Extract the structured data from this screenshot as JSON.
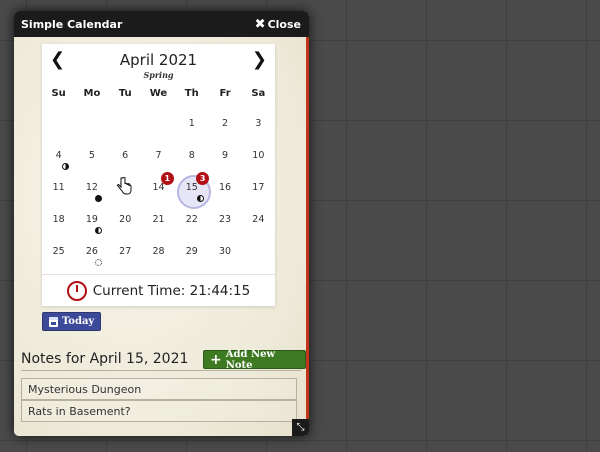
{
  "window": {
    "title": "Simple Calendar",
    "close_label": "Close"
  },
  "calendar": {
    "month_year": "April 2021",
    "season": "Spring",
    "weekdays": [
      "Su",
      "Mo",
      "Tu",
      "We",
      "Th",
      "Fr",
      "Sa"
    ],
    "days": [
      {
        "n": ""
      },
      {
        "n": ""
      },
      {
        "n": ""
      },
      {
        "n": ""
      },
      {
        "n": "1"
      },
      {
        "n": "2"
      },
      {
        "n": "3"
      },
      {
        "n": "4",
        "moon": "half-right"
      },
      {
        "n": "5"
      },
      {
        "n": "6"
      },
      {
        "n": "7"
      },
      {
        "n": "8"
      },
      {
        "n": "9"
      },
      {
        "n": "10"
      },
      {
        "n": "11"
      },
      {
        "n": "12",
        "moon": "new"
      },
      {
        "n": "13"
      },
      {
        "n": "14",
        "badge": "1"
      },
      {
        "n": "15",
        "badge": "3",
        "moon": "half-left",
        "selected": true
      },
      {
        "n": "16"
      },
      {
        "n": "17"
      },
      {
        "n": "18"
      },
      {
        "n": "19",
        "moon": "half-left"
      },
      {
        "n": "20"
      },
      {
        "n": "21"
      },
      {
        "n": "22"
      },
      {
        "n": "23"
      },
      {
        "n": "24"
      },
      {
        "n": "25"
      },
      {
        "n": "26",
        "moon": "full"
      },
      {
        "n": "27"
      },
      {
        "n": "28"
      },
      {
        "n": "29"
      },
      {
        "n": "30"
      },
      {
        "n": ""
      }
    ],
    "current_time_label": "Current Time: 21:44:15"
  },
  "today_button_label": "Today",
  "notes": {
    "heading": "Notes for April 15, 2021",
    "add_button_label": "Add New Note",
    "items": [
      "Mysterious Dungeon",
      "Rats in Basement?"
    ]
  },
  "colors": {
    "accent_red": "#b30f14",
    "today_blue": "#3d4a99",
    "add_green": "#3d7a22"
  }
}
